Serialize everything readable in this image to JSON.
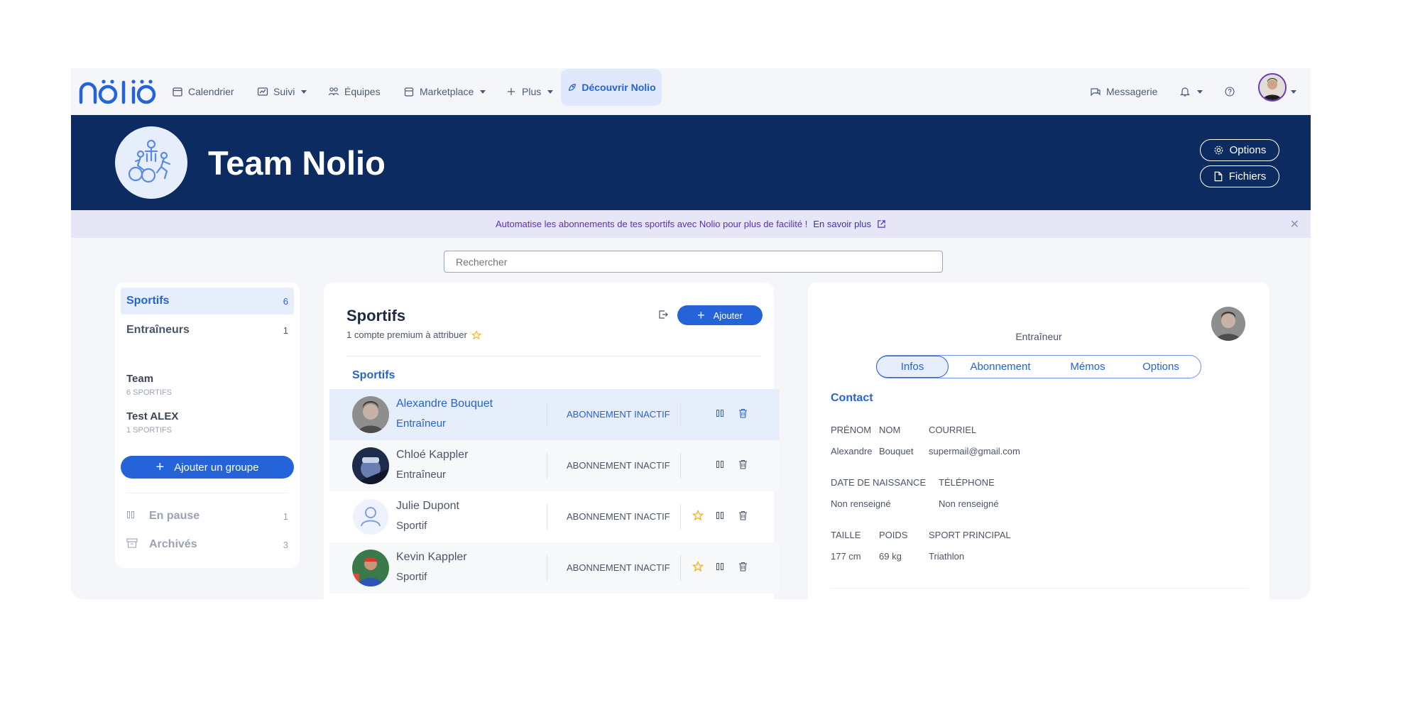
{
  "nav": {
    "logo": "nölïö",
    "items": [
      "Calendrier",
      "Suivi",
      "Équipes",
      "Marketplace",
      "Plus"
    ],
    "discover": "Découvrir Nolio",
    "messagerie": "Messagerie"
  },
  "banner": {
    "team_name": "Team Nolio",
    "options_label": "Options",
    "files_label": "Fichiers"
  },
  "promo": {
    "text": "Automatise les abonnements de tes sportifs avec Nolio pour plus de facilité !",
    "link": "En savoir plus"
  },
  "search": {
    "placeholder": "Rechercher"
  },
  "sidebar": {
    "items": [
      {
        "label": "Sportifs",
        "count": "6"
      },
      {
        "label": "Entraîneurs",
        "count": "1"
      }
    ],
    "groups": [
      {
        "name": "Team",
        "sub": "6 SPORTIFS"
      },
      {
        "name": "Test ALEX",
        "sub": "1 SPORTIFS"
      }
    ],
    "add_group": "Ajouter un groupe",
    "paused": {
      "label": "En pause",
      "count": "1"
    },
    "archived": {
      "label": "Archivés",
      "count": "3"
    }
  },
  "middle": {
    "title": "Sportifs",
    "subtitle": "1 compte premium à attribuer",
    "add_label": "Ajouter",
    "section": "Sportifs",
    "rows": [
      {
        "name": "Alexandre Bouquet",
        "role": "Entraîneur",
        "status": "ABONNEMENT INACTIF"
      },
      {
        "name": "Chloé Kappler",
        "role": "Entraîneur",
        "status": "ABONNEMENT INACTIF"
      },
      {
        "name": "Julie Dupont",
        "role": "Sportif",
        "status": "ABONNEMENT INACTIF"
      },
      {
        "name": "Kevin Kappler",
        "role": "Sportif",
        "status": "ABONNEMENT INACTIF"
      }
    ]
  },
  "detail": {
    "role": "Entraîneur",
    "tabs": [
      "Infos",
      "Abonnement",
      "Mémos",
      "Options"
    ],
    "section": "Contact",
    "labels": {
      "prenom": "PRÉNOM",
      "nom": "NOM",
      "courriel": "COURRIEL",
      "naissance": "DATE DE NAISSANCE",
      "telephone": "TÉLÉPHONE",
      "taille": "TAILLE",
      "poids": "POIDS",
      "sport": "SPORT PRINCIPAL"
    },
    "values": {
      "prenom": "Alexandre",
      "nom": "Bouquet",
      "courriel": "supermail@gmail.com",
      "naissance": "Non renseigné",
      "telephone": "Non renseigné",
      "taille": "177 cm",
      "poids": "69 kg",
      "sport": "Triathlon"
    }
  },
  "colors": {
    "primary": "#2563d8",
    "navy": "#0c2b61",
    "promo_text": "#5a2ec2",
    "star": "#f2b01e"
  }
}
